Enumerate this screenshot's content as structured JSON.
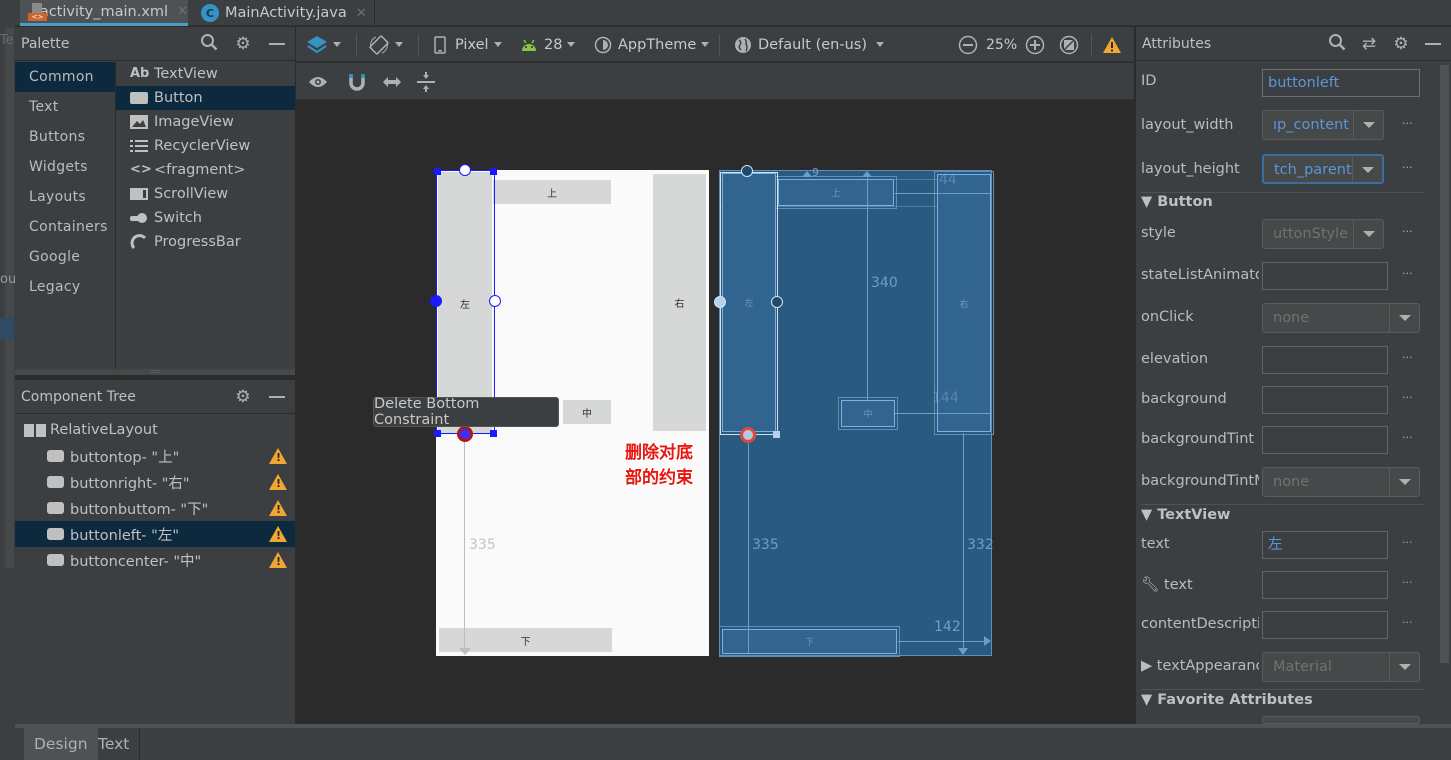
{
  "tabs": [
    {
      "label": "activity_main.xml",
      "active": true,
      "icon": "xml-file-icon"
    },
    {
      "label": "MainActivity.java",
      "active": false,
      "icon": "java-class-icon"
    }
  ],
  "left_strip": {
    "partial_top": "Te",
    "partial_mid": "ou"
  },
  "palette": {
    "title": "Palette",
    "categories": [
      "Common",
      "Text",
      "Buttons",
      "Widgets",
      "Layouts",
      "Containers",
      "Google",
      "Legacy"
    ],
    "selected_category": "Common",
    "items": [
      {
        "label": "TextView",
        "icon": "Ab"
      },
      {
        "label": "Button",
        "icon": "button-icon"
      },
      {
        "label": "ImageView",
        "icon": "image-icon"
      },
      {
        "label": "RecyclerView",
        "icon": "list-icon"
      },
      {
        "label": "<fragment>",
        "icon": "code-icon"
      },
      {
        "label": "ScrollView",
        "icon": "scroll-icon"
      },
      {
        "label": "Switch",
        "icon": "switch-icon"
      },
      {
        "label": "ProgressBar",
        "icon": "progress-icon"
      }
    ],
    "selected_item": "Button"
  },
  "component_tree": {
    "title": "Component Tree",
    "root": "RelativeLayout",
    "children": [
      {
        "label": "buttontop- \"上\"",
        "warning": true
      },
      {
        "label": "buttonright- \"右\"",
        "warning": true
      },
      {
        "label": "buttonbuttom- \"下\"",
        "warning": true
      },
      {
        "label": "buttonleft- \"左\"",
        "warning": true,
        "selected": true
      },
      {
        "label": "buttoncenter- \"中\"",
        "warning": true
      }
    ]
  },
  "toolbar": {
    "device": "Pixel",
    "api": "28",
    "theme": "AppTheme",
    "locale": "Default (en-us)",
    "zoom": "25%"
  },
  "canvas": {
    "buttons": {
      "top": "上",
      "left": "左",
      "right": "右",
      "center": "中",
      "bottom": "下"
    },
    "tooltip": "Delete Bottom Constraint",
    "annotation": "删除对底部的约束",
    "design_dims": {
      "left_bottom": "335"
    },
    "blueprint_dims": {
      "center_top": "340",
      "right_top": "44",
      "right_center": "144",
      "left_bottom": "335",
      "right_bottom": "332",
      "bottom_right": "142",
      "top_left": "9"
    }
  },
  "attributes": {
    "title": "Attributes",
    "id_label": "ID",
    "id_value": "buttonleft",
    "layout_width_label": "layout_width",
    "layout_width_value": "ıp_content",
    "layout_height_label": "layout_height",
    "layout_height_value": "tch_parent",
    "sections": {
      "button": "Button",
      "textview": "TextView",
      "favorites": "Favorite Attributes"
    },
    "style_label": "style",
    "style_value": "uttonStyle",
    "state_label": "stateListAnimato",
    "onclick_label": "onClick",
    "onclick_value": "none",
    "elevation_label": "elevation",
    "background_label": "background",
    "bgtint_label": "backgroundTint",
    "bgtintmode_label": "backgroundTintM",
    "bgtintmode_value": "none",
    "text_label": "text",
    "text_value": "左",
    "tools_text_label": "text",
    "contentdesc_label": "contentDescripti",
    "textappearance_label": "textAppearanc",
    "textappearance_value": "Material"
  },
  "bottom_tabs": {
    "design": "Design",
    "text": "Text"
  },
  "colors": {
    "accent": "#4a9cc9",
    "selection": "#0d293e",
    "warning": "#f0a732",
    "link": "#5d95d7",
    "blueprint": "#2a5a80"
  }
}
